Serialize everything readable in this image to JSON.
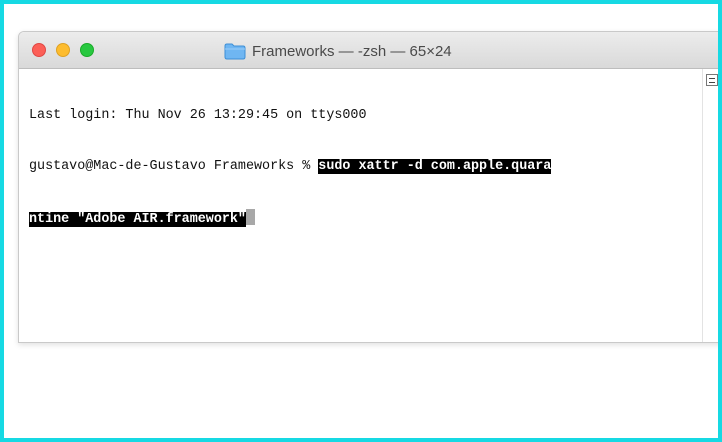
{
  "window": {
    "title": "Frameworks — -zsh — 65×24"
  },
  "terminal": {
    "line1": "Last login: Thu Nov 26 13:29:45 on ttys000",
    "prompt": "gustavo@Mac-de-Gustavo Frameworks % ",
    "selected_part1": "sudo xattr -d com.apple.quara",
    "selected_part2": "ntine \"Adobe AIR.framework\""
  },
  "icons": {
    "title_icon": "folder-icon",
    "scroll_icon": "scroll-handle-icon"
  },
  "colors": {
    "outer_border": "#16d9e3",
    "close": "#fc5f57",
    "minimize": "#fdbc2e",
    "zoom": "#28c840",
    "selection": "#000000"
  }
}
